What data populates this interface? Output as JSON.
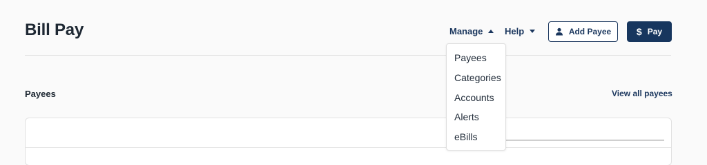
{
  "header": {
    "title": "Bill Pay",
    "manage_label": "Manage",
    "help_label": "Help",
    "add_payee_label": "Add Payee",
    "pay_label": "Pay"
  },
  "manage_menu": {
    "items": [
      "Payees",
      "Categories",
      "Accounts",
      "Alerts",
      "eBills"
    ]
  },
  "payees_section": {
    "title": "Payees",
    "view_all_label": "View all payees"
  },
  "colors": {
    "accent": "#17365e",
    "background": "#fafafa"
  }
}
